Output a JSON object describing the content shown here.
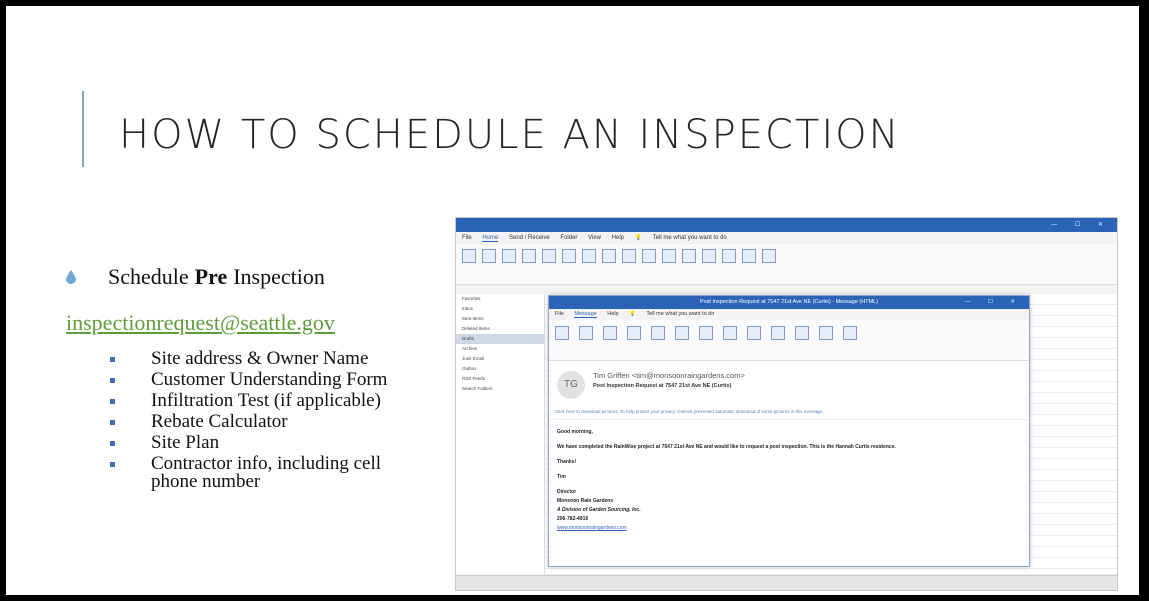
{
  "slide": {
    "title": "HOW TO SCHEDULE AN INSPECTION",
    "main_bullet": {
      "prefix": "Schedule ",
      "bold": "Pre",
      "suffix": " Inspection"
    },
    "email": "inspectionrequest@seattle.gov",
    "sub_items": [
      "Site address & Owner Name",
      "Customer Understanding Form",
      "Infiltration Test (if applicable)",
      "Rebate Calculator",
      "Site Plan",
      "Contractor info, including cell phone number"
    ]
  },
  "colors": {
    "title_text": "#262626",
    "accent_line": "#7da7c9",
    "link": "#5e9e3a",
    "bullet": "#3d6db5",
    "outlook_blue": "#2b63b7"
  },
  "outlook": {
    "tabs": [
      "File",
      "Home",
      "Send / Receive",
      "Folder",
      "View",
      "Help"
    ],
    "tell_me": "Tell me what you want to do",
    "folders": [
      "Favorites",
      "Inbox",
      "Sent Items",
      "Deleted Items",
      "Drafts",
      "Archive",
      "Junk Email",
      "Outbox",
      "RSS Feeds",
      "Search Folders"
    ],
    "message": {
      "title": "Post Inspection Request at 7547 21st Ave NE (Curtis) - Message (HTML)",
      "tabs": [
        "File",
        "Message",
        "Help"
      ],
      "tell_me": "Tell me what you want to do",
      "avatar_initials": "TG",
      "sender": "Tim Griffen <tim@monsoonraingardens.com>",
      "subject": "Post Inspection Request at 7547 21st Ave NE (Curtis)",
      "info": "Click here to download pictures. To help protect your privacy, Outlook prevented automatic download of some pictures in this message.",
      "greeting": "Good morning,",
      "body": "We have completed the RainWise project at 7547 21st Ave NE and would like to request a post inspection. This is the Hannah Curtis residence.",
      "thanks": "Thanks!",
      "name": "Tim",
      "sig_title": "Director",
      "sig_company": "Monsoon Rain Gardens",
      "sig_division": "A Division of Garden Sourcing, Inc.",
      "sig_phone": "206-782-4919",
      "sig_url": "www.monsoonraingardens.com"
    }
  }
}
